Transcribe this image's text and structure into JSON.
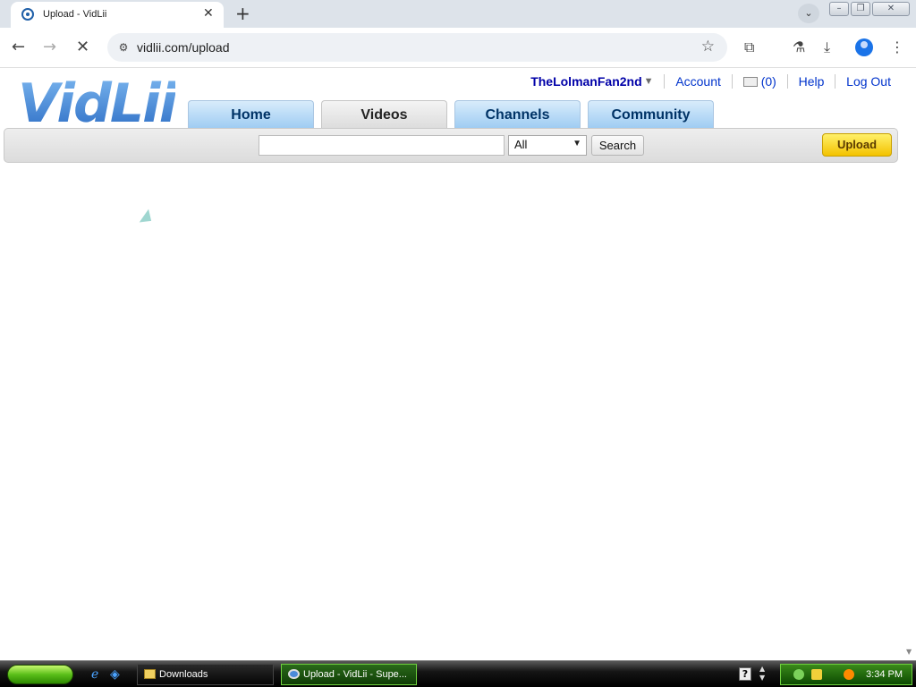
{
  "browser": {
    "tab_title": "Upload - VidLii",
    "url": "vidlii.com/upload",
    "window_buttons": [
      "minimize",
      "restore",
      "close"
    ]
  },
  "site": {
    "logo_text": "VidLii",
    "user": {
      "username": "TheLolmanFan2nd",
      "account_label": "Account",
      "inbox_count": "(0)",
      "help_label": "Help",
      "logout_label": "Log Out"
    },
    "nav_tabs": [
      {
        "label": "Home",
        "active": false
      },
      {
        "label": "Videos",
        "active": true
      },
      {
        "label": "Channels",
        "active": false
      },
      {
        "label": "Community",
        "active": false
      }
    ],
    "search": {
      "value": "",
      "scope_selected": "All",
      "button_label": "Search"
    },
    "upload_button_label": "Upload"
  },
  "taskbar": {
    "tasks": [
      {
        "label": "Downloads"
      },
      {
        "label": "Upload - VidLii - Supe..."
      }
    ],
    "clock": "3:34 PM"
  },
  "colors": {
    "tab_blue": "#9dcbf2",
    "username_blue": "#0000a8",
    "link_blue": "#0033cc",
    "upload_yellow": "#f3c200"
  }
}
